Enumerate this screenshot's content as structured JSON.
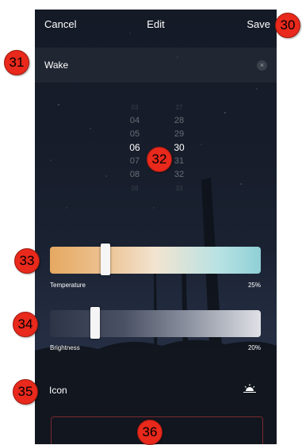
{
  "navbar": {
    "cancel_label": "Cancel",
    "title": "Edit",
    "save_label": "Save"
  },
  "name_field": {
    "value": "Wake",
    "clear_icon": "close-icon",
    "clear_glyph": "×"
  },
  "time_picker": {
    "hours": [
      "03",
      "04",
      "05",
      "06",
      "07",
      "08",
      "09"
    ],
    "minutes": [
      "27",
      "28",
      "29",
      "30",
      "31",
      "32",
      "33"
    ],
    "selected_hour": "06",
    "selected_minute": "30"
  },
  "temperature": {
    "label": "Temperature",
    "value_text": "25%",
    "value": 0.25
  },
  "brightness": {
    "label": "Brightness",
    "value_text": "20%",
    "value": 0.2
  },
  "icon_row": {
    "label": "Icon",
    "icon": "sunrise-icon"
  },
  "annotations": [
    "30",
    "31",
    "32",
    "33",
    "34",
    "35",
    "36"
  ],
  "colors": {
    "badge": "#e8291c",
    "temp_warm": "#e5a861",
    "temp_cool": "#8fd0d6",
    "accent_border": "#7a2a30"
  }
}
